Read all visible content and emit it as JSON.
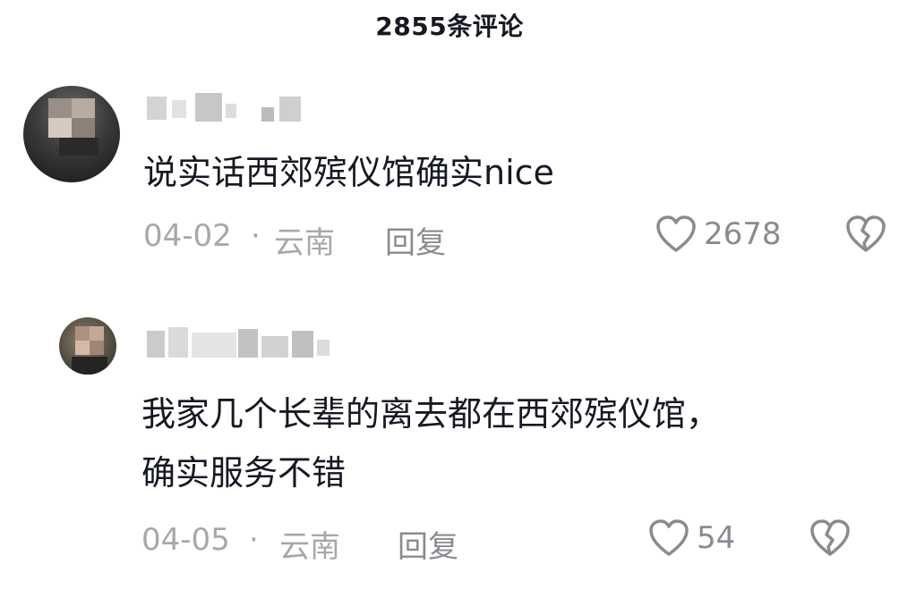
{
  "header": {
    "title": "2855条评论"
  },
  "comments": [
    {
      "text": "说实话西郊殡仪馆确实nice",
      "date": "04-02",
      "location": "云南",
      "separator": "·",
      "reply_label": "回复",
      "likes": "2678"
    },
    {
      "text_line1": "我家几个长辈的离去都在西郊殡仪馆，",
      "text_line2": "确实服务不错",
      "date": "04-05",
      "location": "云南",
      "separator": "·",
      "reply_label": "回复",
      "likes": "54"
    }
  ],
  "icons": {
    "like": "heart-outline-icon",
    "dislike": "broken-heart-icon"
  },
  "colors": {
    "text": "#161823",
    "meta": "#a7a8ab",
    "action": "#8a8b90"
  }
}
